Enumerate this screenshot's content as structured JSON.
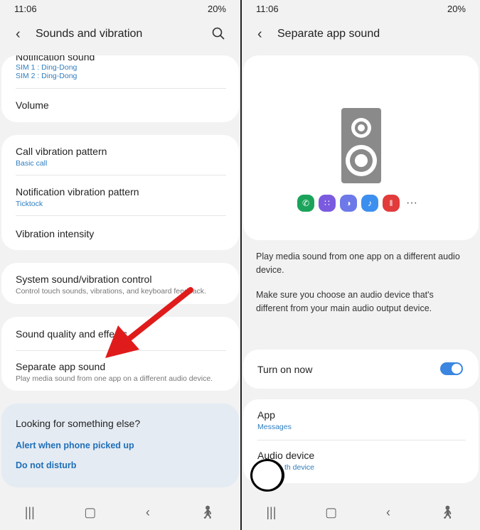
{
  "status": {
    "time": "11:06",
    "battery": "20%"
  },
  "left": {
    "title": "Sounds and vibration",
    "items": [
      {
        "title": "Notification sound",
        "sub1": "SIM 1 : Ding-Dong",
        "sub2": "SIM 2 : Ding-Dong"
      },
      {
        "title": "Volume"
      },
      {
        "title": "Call vibration pattern",
        "sub": "Basic call"
      },
      {
        "title": "Notification vibration pattern",
        "sub": "Ticktock"
      },
      {
        "title": "Vibration intensity"
      },
      {
        "title": "System sound/vibration control",
        "sub": "Control touch sounds, vibrations, and keyboard feedback."
      },
      {
        "title": "Sound quality and effects"
      },
      {
        "title": "Separate app sound",
        "sub": "Play media sound from one app on a different audio device."
      }
    ],
    "looking": {
      "title": "Looking for something else?",
      "links": [
        "Alert when phone picked up",
        "Do not disturb"
      ]
    }
  },
  "right": {
    "title": "Separate app sound",
    "apps": [
      "phone",
      "game-launcher",
      "internet",
      "music",
      "voice-recorder"
    ],
    "desc1": "Play media sound from one app on a different audio device.",
    "desc2": "Make sure you choose an audio device that's different from your main audio output device.",
    "toggle": {
      "label": "Turn on now",
      "on": true
    },
    "app": {
      "title": "App",
      "value": "Messages"
    },
    "audio": {
      "title": "Audio device",
      "value": "th device"
    }
  },
  "colors": {
    "accent": "#3a86e0",
    "link": "#2e7dbf",
    "arrow": "#e01b1b"
  }
}
